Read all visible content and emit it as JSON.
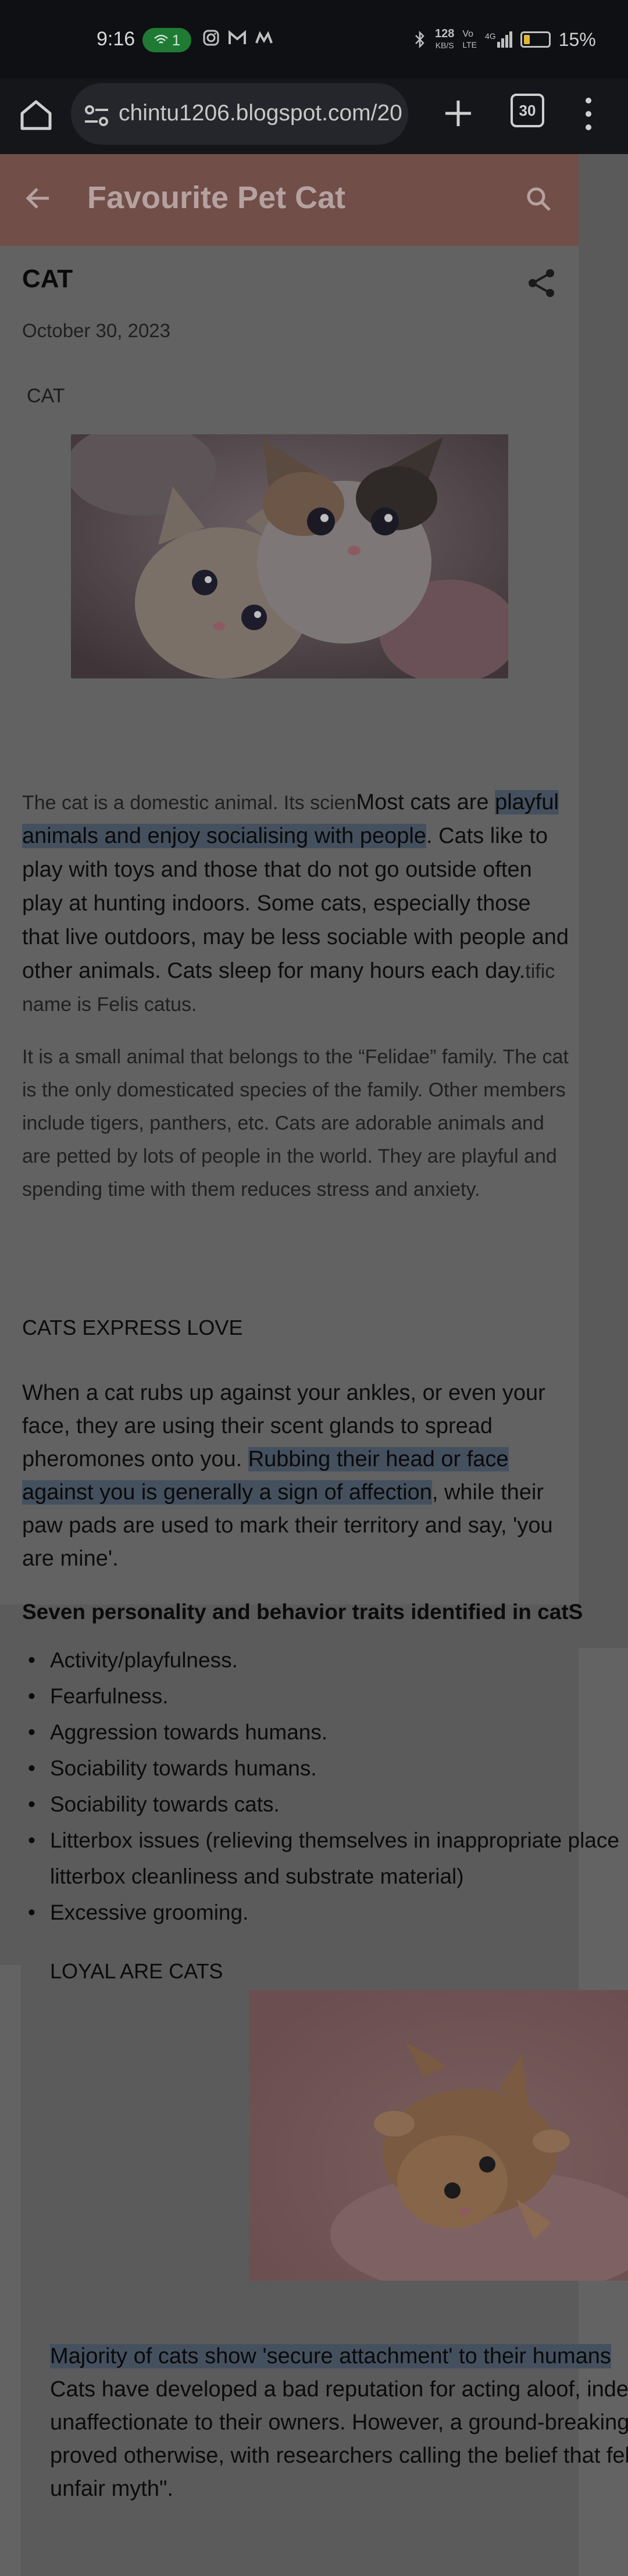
{
  "status_bar": {
    "time": "9:16",
    "call_count": "1",
    "net_speed_top": "128",
    "net_speed_bottom": "KB/S",
    "vo_label": "Vo",
    "lte_label": "LTE",
    "signal_label": "4G",
    "battery_percent": "15%",
    "battery_level": 0.15,
    "icons": [
      "instagram-icon",
      "gmail-icon",
      "m-app-icon",
      "bluetooth-icon",
      "signal-icon",
      "battery-icon"
    ]
  },
  "browser": {
    "url": "chintu1206.blogspot.com/20",
    "tab_count": "30"
  },
  "blog": {
    "title": "Favourite Pet Cat"
  },
  "post": {
    "title": "CAT",
    "date": "October 30, 2023",
    "label": "CAT",
    "para1": {
      "t1": "The cat is a domestic animal. Its scien",
      "t2": "Most cats are ",
      "h1": "playful animals and enjoy socialising with people",
      "t3": ". Cats like to play with toys and those that do not go outside often play at hunting indoors. Some cats, especially those that live outdoors, may be less sociable with people and other animals. Cats sleep for many hours each day.",
      "t4": "tific name is Felis catus."
    },
    "para2": " It is a small animal that belongs to the “Felidae” family. The cat is the only domesticated species of the family. Other members include tigers, panthers, etc. Cats are adorable animals and are petted by lots of people in the world. They are playful and spending time with them reduces stress and anxiety.",
    "section1_title": "CATS EXPRESS LOVE",
    "para3": {
      "t1": "When a cat rubs up against your ankles, or even your face, they are using their scent glands to spread pheromones onto you. ",
      "h1": "Rubbing their head or face against you is generally a sign of affection",
      "t2": ", while their paw pads are used to mark their territory and say, 'you are mine'."
    },
    "traits_title": "Seven personality and behavior traits identified in catS",
    "traits": [
      "Activity/playfulness.",
      "Fearfulness.",
      "Aggression towards humans.",
      "Sociability towards humans.",
      "Sociability towards cats.",
      "Litterbox issues (relieving themselves in inappropriate place litterbox cleanliness and substrate material)",
      "Excessive grooming."
    ],
    "section2_title": "LOYAL ARE CATS",
    "para4": {
      "h1": "Majority of cats show 'secure attachment' to their humans",
      "l1": "Cats have developed a bad reputation for acting aloof, indep",
      "l2": "unaffectionate to their owners. However, a ground-breaking",
      "l3": "proved otherwise, with researchers calling the belief that feli",
      "l4": "unfair myth\"."
    }
  },
  "colors": {
    "status_bg": "#0f1013",
    "toolbar_bg": "#15161a",
    "header_bg": "#714e48",
    "page_dim": "#626262",
    "highlight": "#45505f"
  }
}
